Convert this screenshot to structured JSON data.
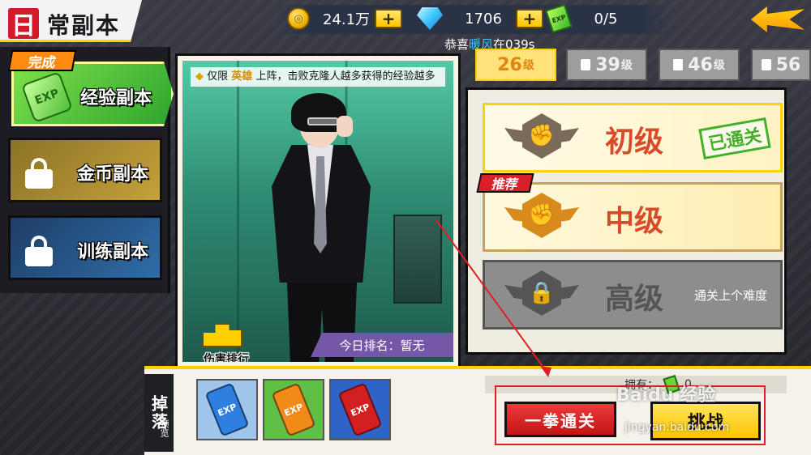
{
  "title": {
    "first_char": "日",
    "rest": "常副本"
  },
  "resources": {
    "coins": "24.1万",
    "gems": "1706",
    "tickets": "0/5",
    "plus": "+"
  },
  "marquee": {
    "prefix": "恭喜",
    "name": "暖风",
    "suffix": "在039s"
  },
  "left_tabs": {
    "done_badge": "完成",
    "exp": "经验副本",
    "gold": "金币副本",
    "train": "训练副本",
    "exp_icon_text": "EXP"
  },
  "hero": {
    "desc_prefix": "仅限",
    "desc_highlight": "英雄",
    "desc_suffix": "上阵，击败克隆人越多获得的经验越多",
    "damage_rank": "伤害排行",
    "podium_numbers": "2 1 3",
    "today_rank": "今日排名：暂无"
  },
  "level_tabs": [
    {
      "num": "26",
      "unit": "级",
      "active": true
    },
    {
      "num": "39",
      "unit": "级",
      "active": false
    },
    {
      "num": "46",
      "unit": "级",
      "active": false
    },
    {
      "num": "56",
      "unit": "",
      "active": false
    }
  ],
  "difficulties": {
    "easy": {
      "name": "初级",
      "stamp": "已通关"
    },
    "mid": {
      "name": "中级",
      "recommend": "推荐"
    },
    "hard": {
      "name": "高级",
      "note": "通关上个难度"
    }
  },
  "drops": {
    "label": "掉落",
    "sub": "预览",
    "items": [
      {
        "name": "蓝色经验药水",
        "color": "#2e7fe0",
        "bg": "#9fc6ea",
        "text": "EXP"
      },
      {
        "name": "橙色经验药水",
        "color": "#f08a18",
        "bg": "#5fbf46",
        "text": "EXP"
      },
      {
        "name": "红色经验药水",
        "color": "#d22020",
        "bg": "#2f63c6",
        "text": "EXP"
      }
    ]
  },
  "owned": {
    "label": "拥有：",
    "count": "0"
  },
  "buttons": {
    "punch": "一拳通关",
    "challenge": "挑战"
  },
  "watermark": {
    "main": "Baidu 经验",
    "sub": "jingyan.baidu.com"
  }
}
